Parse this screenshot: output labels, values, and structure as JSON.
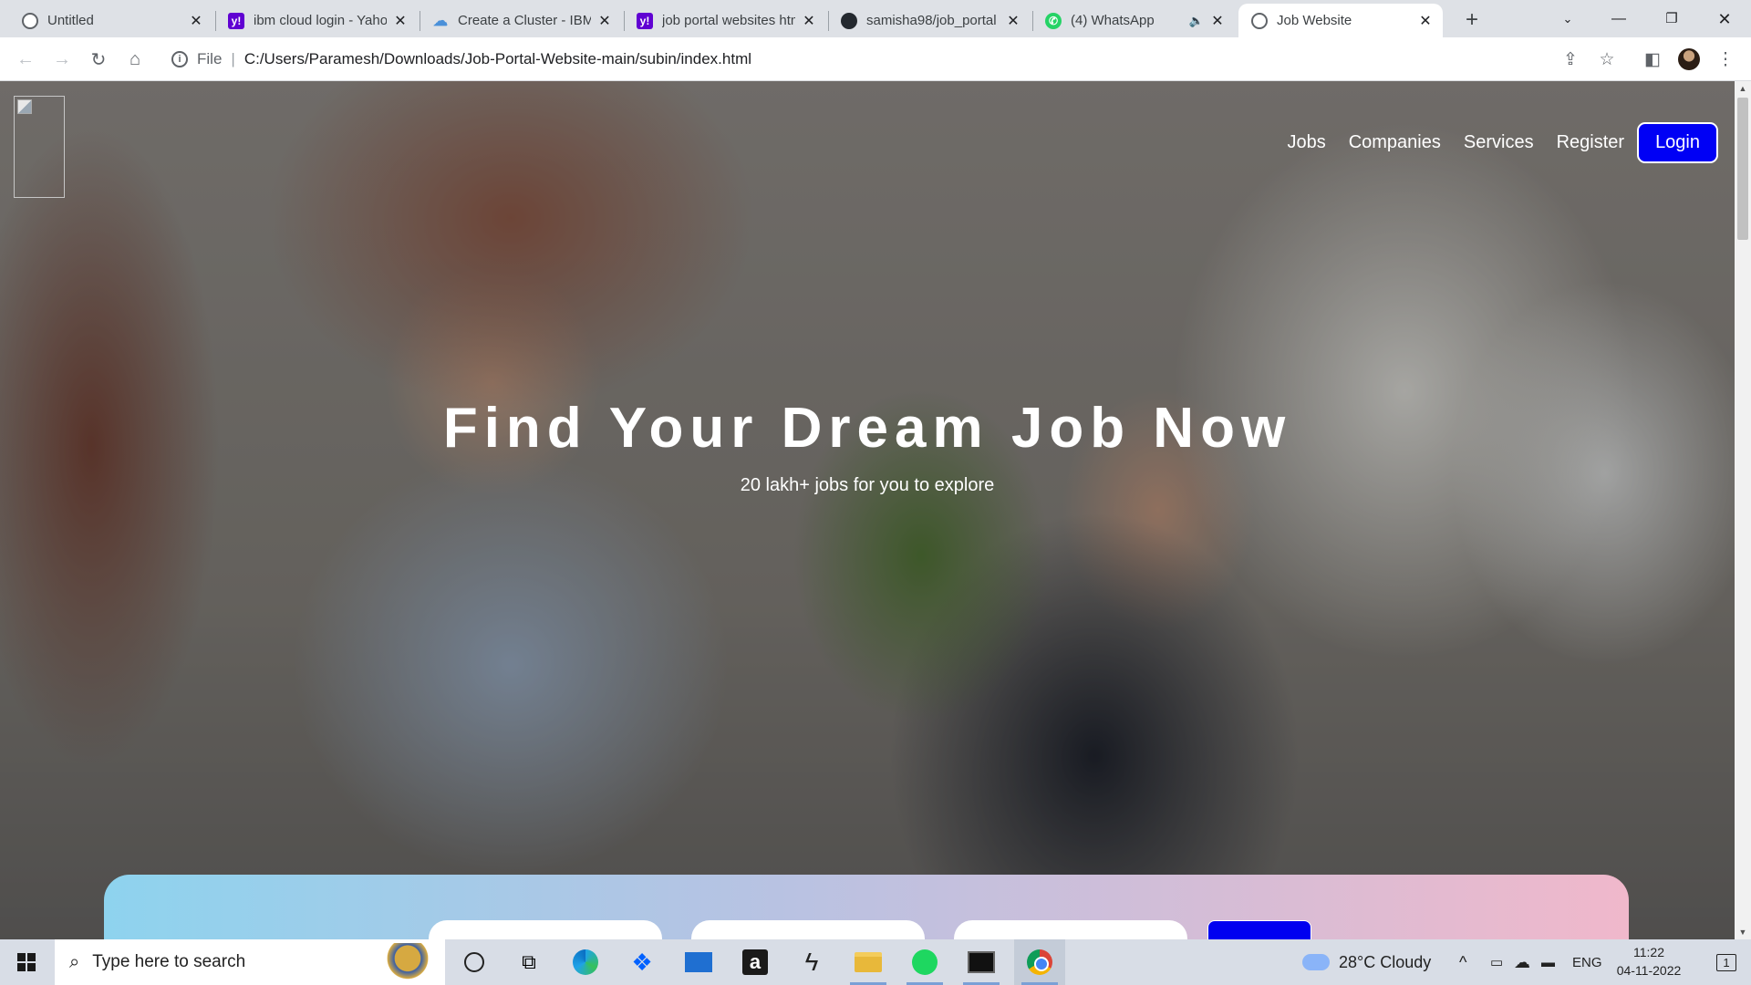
{
  "browser": {
    "tabs": [
      {
        "title": "Untitled",
        "favicon": "globe-icon"
      },
      {
        "title": "ibm cloud login - Yahoo",
        "favicon": "yahoo-icon"
      },
      {
        "title": "Create a Cluster - IBM",
        "favicon": "cloud-icon"
      },
      {
        "title": "job portal websites html",
        "favicon": "yahoo-icon"
      },
      {
        "title": "samisha98/job_portal",
        "favicon": "github-icon"
      },
      {
        "title": "(4) WhatsApp",
        "favicon": "whatsapp-icon"
      },
      {
        "title": "Job Website",
        "favicon": "globe-icon",
        "active": true
      }
    ],
    "new_tab": "+",
    "address": {
      "scheme": "File",
      "url": "C:/Users/Paramesh/Downloads/Job-Portal-Website-main/subin/index.html"
    }
  },
  "page": {
    "nav": {
      "links": [
        "Jobs",
        "Companies",
        "Services",
        "Register"
      ],
      "login": "Login"
    },
    "hero": {
      "title": "Find Your Dream Job Now",
      "subtitle": "20 lakh+ jobs for you to explore"
    },
    "colors": {
      "login_bg": "#0000f5",
      "panel_gradient_start": "#8ed3ee",
      "panel_gradient_end": "#f0b8cb"
    }
  },
  "taskbar": {
    "search_placeholder": "Type here to search",
    "weather": "28°C  Cloudy",
    "language": "ENG",
    "time": "11:22",
    "date": "04-11-2022",
    "notifications": "1",
    "apps": [
      "cortana-icon",
      "task-view-icon",
      "edge-icon",
      "dropbox-icon",
      "mail-icon",
      "amazon-icon",
      "bolt-app-icon",
      "file-explorer-icon",
      "spotify-icon",
      "terminal-icon",
      "chrome-icon"
    ]
  }
}
